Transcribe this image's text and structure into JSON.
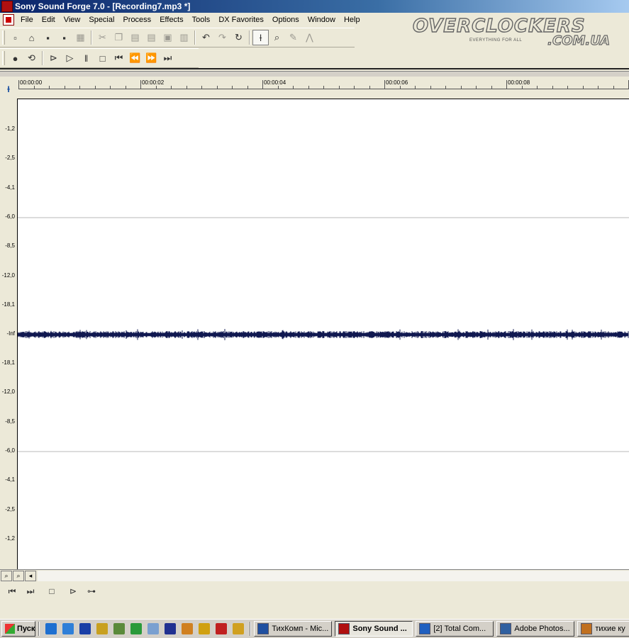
{
  "window": {
    "title": "Sony Sound Forge 7.0 - [Recording7.mp3 *]"
  },
  "menu": [
    "File",
    "Edit",
    "View",
    "Special",
    "Process",
    "Effects",
    "Tools",
    "DX Favorites",
    "Options",
    "Window",
    "Help"
  ],
  "logo": {
    "main": "OVERCLOCKERS",
    "sub": ".COM.UA",
    "tagline": "EVERYTHING FOR ALL"
  },
  "toolbar_standard": [
    {
      "name": "new-icon",
      "glyph": "▫"
    },
    {
      "name": "open-icon",
      "glyph": "⌂"
    },
    {
      "name": "save-icon",
      "glyph": "▪"
    },
    {
      "name": "save-as-icon",
      "glyph": "▪"
    },
    {
      "name": "save-all-icon",
      "glyph": "▦"
    },
    {
      "name": "cut-icon",
      "glyph": "✂"
    },
    {
      "name": "copy-icon",
      "glyph": "❐"
    },
    {
      "name": "paste-icon",
      "glyph": "▤"
    },
    {
      "name": "mix-icon",
      "glyph": "▤"
    },
    {
      "name": "crop-icon",
      "glyph": "▣"
    },
    {
      "name": "trim-icon",
      "glyph": "▥"
    },
    {
      "name": "undo-icon",
      "glyph": "↶"
    },
    {
      "name": "redo-icon",
      "glyph": "↷"
    },
    {
      "name": "repeat-icon",
      "glyph": "↻"
    },
    {
      "name": "edit-tool-icon",
      "glyph": "Ɨ"
    },
    {
      "name": "magnify-tool-icon",
      "glyph": "⌕"
    },
    {
      "name": "pencil-tool-icon",
      "glyph": "✎"
    },
    {
      "name": "envelope-tool-icon",
      "glyph": "⋀"
    }
  ],
  "toolbar_transport": [
    {
      "name": "record-icon",
      "glyph": "●"
    },
    {
      "name": "loop-icon",
      "glyph": "⟲"
    },
    {
      "name": "play-all-icon",
      "glyph": "⊳"
    },
    {
      "name": "play-icon",
      "glyph": "▷"
    },
    {
      "name": "pause-icon",
      "glyph": "‖"
    },
    {
      "name": "stop-icon",
      "glyph": "□"
    },
    {
      "name": "go-to-start-icon",
      "glyph": "⏮"
    },
    {
      "name": "rewind-icon",
      "glyph": "⏪"
    },
    {
      "name": "forward-icon",
      "glyph": "⏩"
    },
    {
      "name": "go-to-end-icon",
      "glyph": "⏭"
    }
  ],
  "ruler": {
    "labels": [
      "00:00:00",
      "00:00:02",
      "00:00:04",
      "00:00:06",
      "00:00:08"
    ]
  },
  "db_scale": {
    "labels": [
      "-1,2",
      "-2,5",
      "-4,1",
      "-6,0",
      "-8,5",
      "-12,0",
      "-18,1",
      "-Inf",
      "-18,1",
      "-12,0",
      "-8,5",
      "-6,0",
      "-4,1",
      "-2,5",
      "-1,2"
    ]
  },
  "waveform": {
    "color": "#101850",
    "background": "#ffffff",
    "gridline_color": "#b8b8b8",
    "level": "-Inf"
  },
  "bottom_controls": [
    {
      "name": "zoom-in-icon",
      "glyph": "⌕"
    },
    {
      "name": "zoom-out-icon",
      "glyph": "⌕"
    },
    {
      "name": "scroll-left-icon",
      "glyph": "◂"
    }
  ],
  "doc_transport": [
    {
      "name": "go-to-start-icon",
      "glyph": "⏮"
    },
    {
      "name": "go-to-end-icon",
      "glyph": "⏭"
    },
    {
      "name": "stop-icon",
      "glyph": "□"
    },
    {
      "name": "play-icon",
      "glyph": "⊳"
    },
    {
      "name": "play-plug-icon",
      "glyph": "⊶"
    }
  ],
  "taskbar": {
    "start_label": "Пуск",
    "quick_launch": [
      {
        "name": "ie-icon",
        "color": "#1e6fd0"
      },
      {
        "name": "outlook-icon",
        "color": "#2f7fd8"
      },
      {
        "name": "floppy-icon",
        "color": "#1a3fa6"
      },
      {
        "name": "tool-icon",
        "color": "#c8a020"
      },
      {
        "name": "satellite-icon",
        "color": "#5a8a3a"
      },
      {
        "name": "globe-icon",
        "color": "#2a9a3a"
      },
      {
        "name": "network-icon",
        "color": "#7aa0d0"
      },
      {
        "name": "m-icon",
        "color": "#203090"
      },
      {
        "name": "heart-icon",
        "color": "#d08020"
      },
      {
        "name": "u-icon",
        "color": "#d0a010"
      },
      {
        "name": "red-icon",
        "color": "#c02020"
      },
      {
        "name": "clock-icon",
        "color": "#d0a020"
      }
    ],
    "tasks": [
      {
        "label": "ТихКомп - Mic...",
        "icon_color": "#2050a0",
        "active": false
      },
      {
        "label": "Sony Sound ...",
        "icon_color": "#b01010",
        "active": true
      },
      {
        "label": "[2] Total Com...",
        "icon_color": "#2060c0",
        "active": false
      },
      {
        "label": "Adobe Photos...",
        "icon_color": "#3060a0",
        "active": false
      },
      {
        "label": "тихие ку",
        "icon_color": "#c07020",
        "active": false
      }
    ]
  }
}
